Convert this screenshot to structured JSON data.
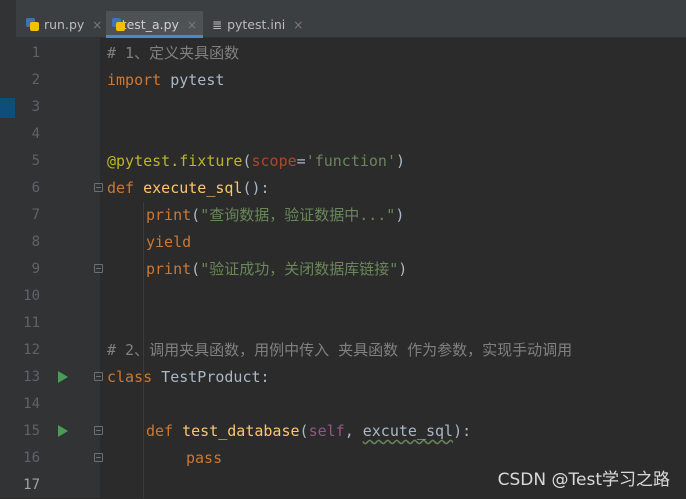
{
  "tabs": [
    {
      "label": "run.py",
      "icon": "python-file-icon",
      "active": false
    },
    {
      "label": "test_a.py",
      "icon": "python-file-icon",
      "active": true
    },
    {
      "label": "pytest.ini",
      "icon": "ini-file-icon",
      "active": false
    }
  ],
  "close_glyph": "×",
  "line_numbers": [
    "1",
    "2",
    "3",
    "4",
    "5",
    "6",
    "7",
    "8",
    "9",
    "10",
    "11",
    "12",
    "13",
    "14",
    "15",
    "16",
    "17"
  ],
  "current_line": "17",
  "code": {
    "l1": "# 1、定义夹具函数",
    "l2_kw": "import",
    "l2_rest": " pytest",
    "l5_deco": "@pytest.fixture",
    "l5_open": "(",
    "l5_param": "scope",
    "l5_eq": "=",
    "l5_str": "'function'",
    "l5_close": ")",
    "l6_kw": "def",
    "l6_fn": "execute_sql",
    "l6_rest": "():",
    "l7_call": "print",
    "l7_open": "(",
    "l7_str": "\"查询数据，验证数据中...\"",
    "l7_close": ")",
    "l8_kw": "yield",
    "l9_call": "print",
    "l9_open": "(",
    "l9_str": "\"验证成功，关闭数据库链接\"",
    "l9_close": ")",
    "l12": "# 2、调用夹具函数，用例中传入 夹具函数 作为参数，实现手动调用",
    "l13_kw": "class",
    "l13_rest": " TestProduct:",
    "l15_kw": "def",
    "l15_fn": "test_database",
    "l15_open": "(",
    "l15_self": "self",
    "l15_comma": ", ",
    "l15_arg": "excute_sql",
    "l15_close": "):",
    "l16_kw": "pass"
  },
  "watermark": "CSDN @Test学习之路",
  "colors": {
    "background": "#2b2b2b",
    "keyword": "#cc7832",
    "comment": "#808080",
    "string": "#6a8759",
    "decorator": "#bbb529",
    "function_name": "#ffc66d",
    "run_icon": "#499c54",
    "active_tab_underline": "#4a88c7"
  }
}
